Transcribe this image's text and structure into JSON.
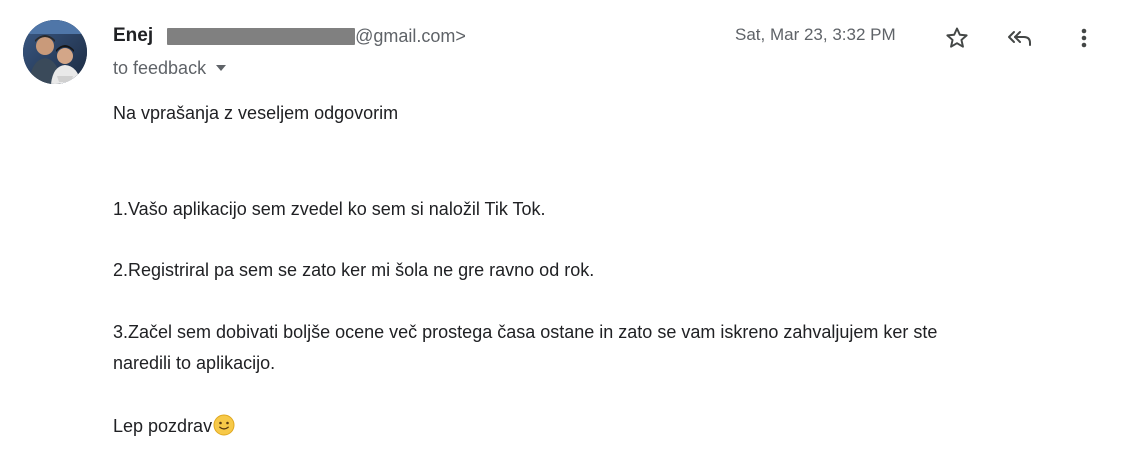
{
  "message": {
    "sender_name": "Enej",
    "sender_email_suffix": "@gmail.com>",
    "recipient_label": "to feedback",
    "date": "Sat, Mar 23, 3:32 PM",
    "greeting": "Na vprašanja z veseljem odgovorim",
    "answers": [
      "1.Vašo aplikacijo sem zvedel ko sem si naložil Tik Tok.",
      "2.Registriral pa sem se zato ker mi šola ne gre ravno od rok.",
      "3.Začel sem dobivati boljše ocene več prostega časa ostane in zato se vam iskreno zahvaljujem ker ste",
      "naredili to aplikacijo."
    ],
    "signoff": "Lep pozdrav"
  },
  "icons": {
    "star": "star-icon",
    "reply_all": "reply-all-icon",
    "more": "more-vert-icon",
    "emoji": "slightly-smiling-face-emoji",
    "caret": "chevron-down-icon"
  },
  "colors": {
    "primary_text": "#202124",
    "secondary_text": "#5f6368",
    "redaction": "#808080",
    "background": "#ffffff"
  }
}
